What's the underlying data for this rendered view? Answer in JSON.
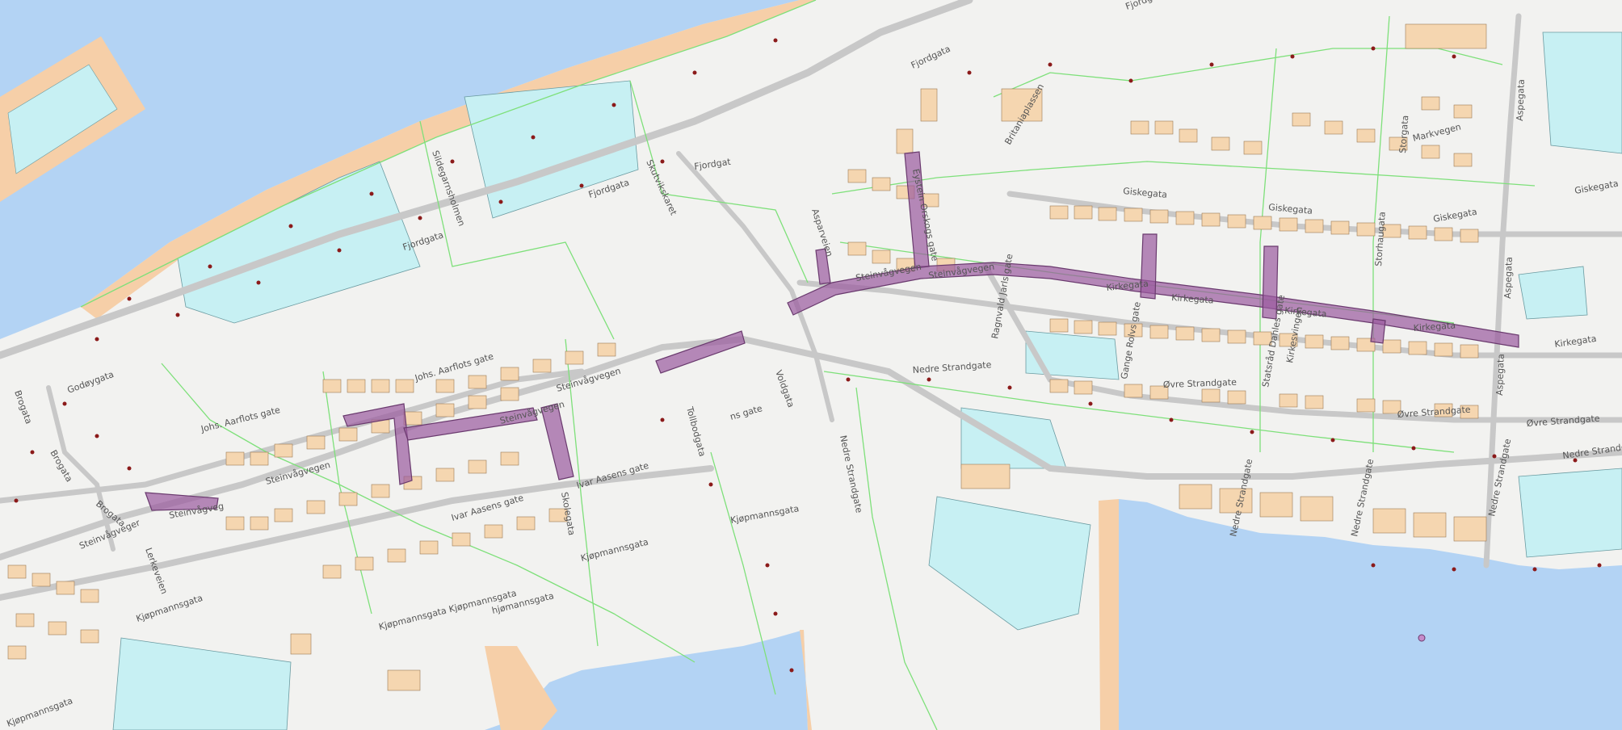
{
  "colors": {
    "sea": "#b3d3f4",
    "land": "#f2f2f0",
    "quay": "#f6cfa8",
    "property_line": "#7ee07a",
    "building_large": "#c7f0f3",
    "building_small": "#f5d6b0",
    "road": "#c8c8c8",
    "highlight": "#9a5a9e",
    "point": "#8b1a1a"
  },
  "labels": {
    "fjordgata": "Fjordgata",
    "fjordgat": "Fjordgat",
    "fjordg": "Fjordg",
    "sildegarnsholmen": "Sildegarnsholmen",
    "skutvikskaret": "Skutvikskaret",
    "godoygata": "Godøygata",
    "johs_aarflots_gate": "Johs. Aarflots gate",
    "steinvagvegen": "Steinvågvegen",
    "steinvagveg": "Steinvågveg",
    "steinvagveger": "Steinvågveger",
    "eystein_orskogsgate": "Eystein Orskogs gate",
    "asparveien": "Asparveien",
    "giskegata": "Giskegata",
    "kirkegata": "Kirkegata",
    "markvegen": "Markvegen",
    "aspegata": "Aspegata",
    "storhaugata": "Storhaugata",
    "storgata": "Storgata",
    "nedre_strandgate": "Nedre Strandgate",
    "ovre_strandgate": "Øvre Strandgate",
    "ragnvald_jarls_gate": "Ragnvald Jarls gate",
    "gange_rolvs_gate": "Gange Rolvs gate",
    "statsrad_dahles_gate": "Statsråd Dahles gate",
    "ivar_aasens_gate": "Ivar Aasens gate",
    "ns_gate": "ns gate",
    "kjopmannsgata": "Kjøpmannsgata",
    "kjopmannsgata_kjopmannsgata": "Kjøpmannsgata Kjøpmannsgata",
    "hjomannsgata": "hjømannsgata",
    "brogata": "Brogata",
    "skolegata": "Skolegata",
    "lerkeveien": "Lerkeveien",
    "britaniaplassen": "Britaniaplassen",
    "voldgata": "Voldgata",
    "tollbodgata": "Tollbodgata",
    "kirkesvingen": "Kirkesvingen"
  }
}
